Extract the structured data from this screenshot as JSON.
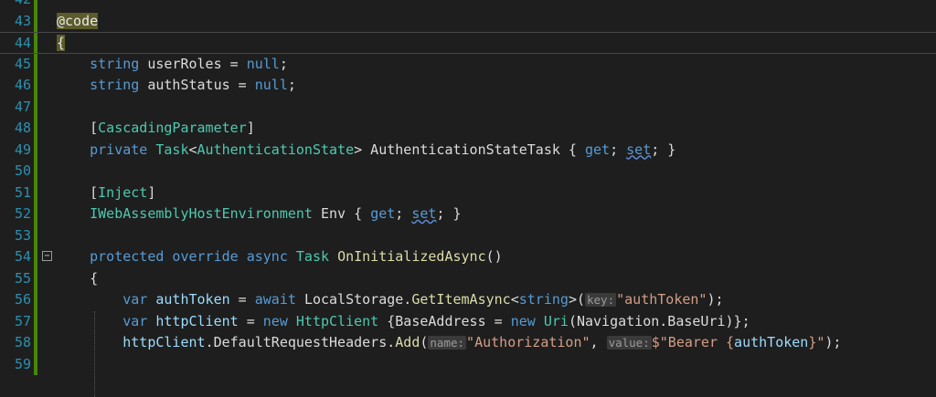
{
  "editor": {
    "lines": [
      {
        "num": "42",
        "tokens": []
      },
      {
        "num": "43",
        "tokens": [
          {
            "t": "@code",
            "c": "hl"
          }
        ]
      },
      {
        "num": "44",
        "tokens": [
          {
            "t": "{",
            "c": "hl"
          }
        ],
        "current": true
      },
      {
        "num": "45",
        "tokens": [
          {
            "t": "    string ",
            "c": "kw"
          },
          {
            "t": "userRoles",
            "c": "pl"
          },
          {
            "t": " = ",
            "c": "pl"
          },
          {
            "t": "null",
            "c": "kw"
          },
          {
            "t": ";",
            "c": "pl"
          }
        ]
      },
      {
        "num": "46",
        "tokens": [
          {
            "t": "    string ",
            "c": "kw"
          },
          {
            "t": "authStatus",
            "c": "pl"
          },
          {
            "t": " = ",
            "c": "pl"
          },
          {
            "t": "null",
            "c": "kw"
          },
          {
            "t": ";",
            "c": "pl"
          }
        ]
      },
      {
        "num": "47",
        "tokens": []
      },
      {
        "num": "48",
        "tokens": [
          {
            "t": "    [",
            "c": "pl"
          },
          {
            "t": "CascadingParameter",
            "c": "ty"
          },
          {
            "t": "]",
            "c": "pl"
          }
        ]
      },
      {
        "num": "49",
        "tokens": [
          {
            "t": "    private ",
            "c": "kw"
          },
          {
            "t": "Task",
            "c": "ty"
          },
          {
            "t": "<",
            "c": "pl"
          },
          {
            "t": "AuthenticationState",
            "c": "ty"
          },
          {
            "t": "> AuthenticationStateTask { ",
            "c": "pl"
          },
          {
            "t": "get",
            "c": "kw"
          },
          {
            "t": "; ",
            "c": "pl"
          },
          {
            "t": "set",
            "c": "kw sq"
          },
          {
            "t": "; }",
            "c": "pl"
          }
        ]
      },
      {
        "num": "50",
        "tokens": []
      },
      {
        "num": "51",
        "tokens": [
          {
            "t": "    [",
            "c": "pl"
          },
          {
            "t": "Inject",
            "c": "ty"
          },
          {
            "t": "]",
            "c": "pl"
          }
        ]
      },
      {
        "num": "52",
        "tokens": [
          {
            "t": "    IWebAssemblyHostEnvironment",
            "c": "ty"
          },
          {
            "t": " Env { ",
            "c": "pl"
          },
          {
            "t": "get",
            "c": "kw"
          },
          {
            "t": "; ",
            "c": "pl"
          },
          {
            "t": "set",
            "c": "kw sq"
          },
          {
            "t": "; }",
            "c": "pl"
          }
        ]
      },
      {
        "num": "53",
        "tokens": []
      },
      {
        "num": "54",
        "tokens": [
          {
            "t": "    protected override async ",
            "c": "kw"
          },
          {
            "t": "Task",
            "c": "ty"
          },
          {
            "t": " ",
            "c": "pl"
          },
          {
            "t": "OnInitializedAsync",
            "c": "fn"
          },
          {
            "t": "()",
            "c": "pl"
          }
        ],
        "fold": true
      },
      {
        "num": "55",
        "tokens": [
          {
            "t": "    {",
            "c": "pl"
          }
        ]
      },
      {
        "num": "56",
        "tokens": [
          {
            "t": "        var ",
            "c": "kw"
          },
          {
            "t": "authToken",
            "c": "id"
          },
          {
            "t": " = ",
            "c": "pl"
          },
          {
            "t": "await ",
            "c": "kw"
          },
          {
            "t": "LocalStorage.",
            "c": "pl"
          },
          {
            "t": "GetItemAsync",
            "c": "fn"
          },
          {
            "t": "<",
            "c": "pl"
          },
          {
            "t": "string",
            "c": "kw"
          },
          {
            "t": ">(",
            "c": "pl"
          },
          {
            "t": "key:",
            "c": "hint"
          },
          {
            "t": "\"authToken\"",
            "c": "st"
          },
          {
            "t": ");",
            "c": "pl"
          }
        ]
      },
      {
        "num": "57",
        "tokens": [
          {
            "t": "        var ",
            "c": "kw"
          },
          {
            "t": "httpClient",
            "c": "id"
          },
          {
            "t": " = ",
            "c": "pl"
          },
          {
            "t": "new ",
            "c": "kw"
          },
          {
            "t": "HttpClient",
            "c": "ty"
          },
          {
            "t": " {BaseAddress = ",
            "c": "pl"
          },
          {
            "t": "new ",
            "c": "kw"
          },
          {
            "t": "Uri",
            "c": "ty"
          },
          {
            "t": "(Navigation.BaseUri)};",
            "c": "pl"
          }
        ]
      },
      {
        "num": "58",
        "tokens": [
          {
            "t": "        httpClient",
            "c": "id"
          },
          {
            "t": ".DefaultRequestHeaders.",
            "c": "pl"
          },
          {
            "t": "Add",
            "c": "fn"
          },
          {
            "t": "(",
            "c": "pl"
          },
          {
            "t": "name:",
            "c": "hint"
          },
          {
            "t": "\"Authorization\"",
            "c": "st"
          },
          {
            "t": ", ",
            "c": "pl"
          },
          {
            "t": "value:",
            "c": "hint"
          },
          {
            "t": "$\"Bearer {",
            "c": "st"
          },
          {
            "t": "authToken",
            "c": "id"
          },
          {
            "t": "}\"",
            "c": "st"
          },
          {
            "t": ");",
            "c": "pl"
          }
        ]
      },
      {
        "num": "59",
        "tokens": []
      }
    ]
  }
}
